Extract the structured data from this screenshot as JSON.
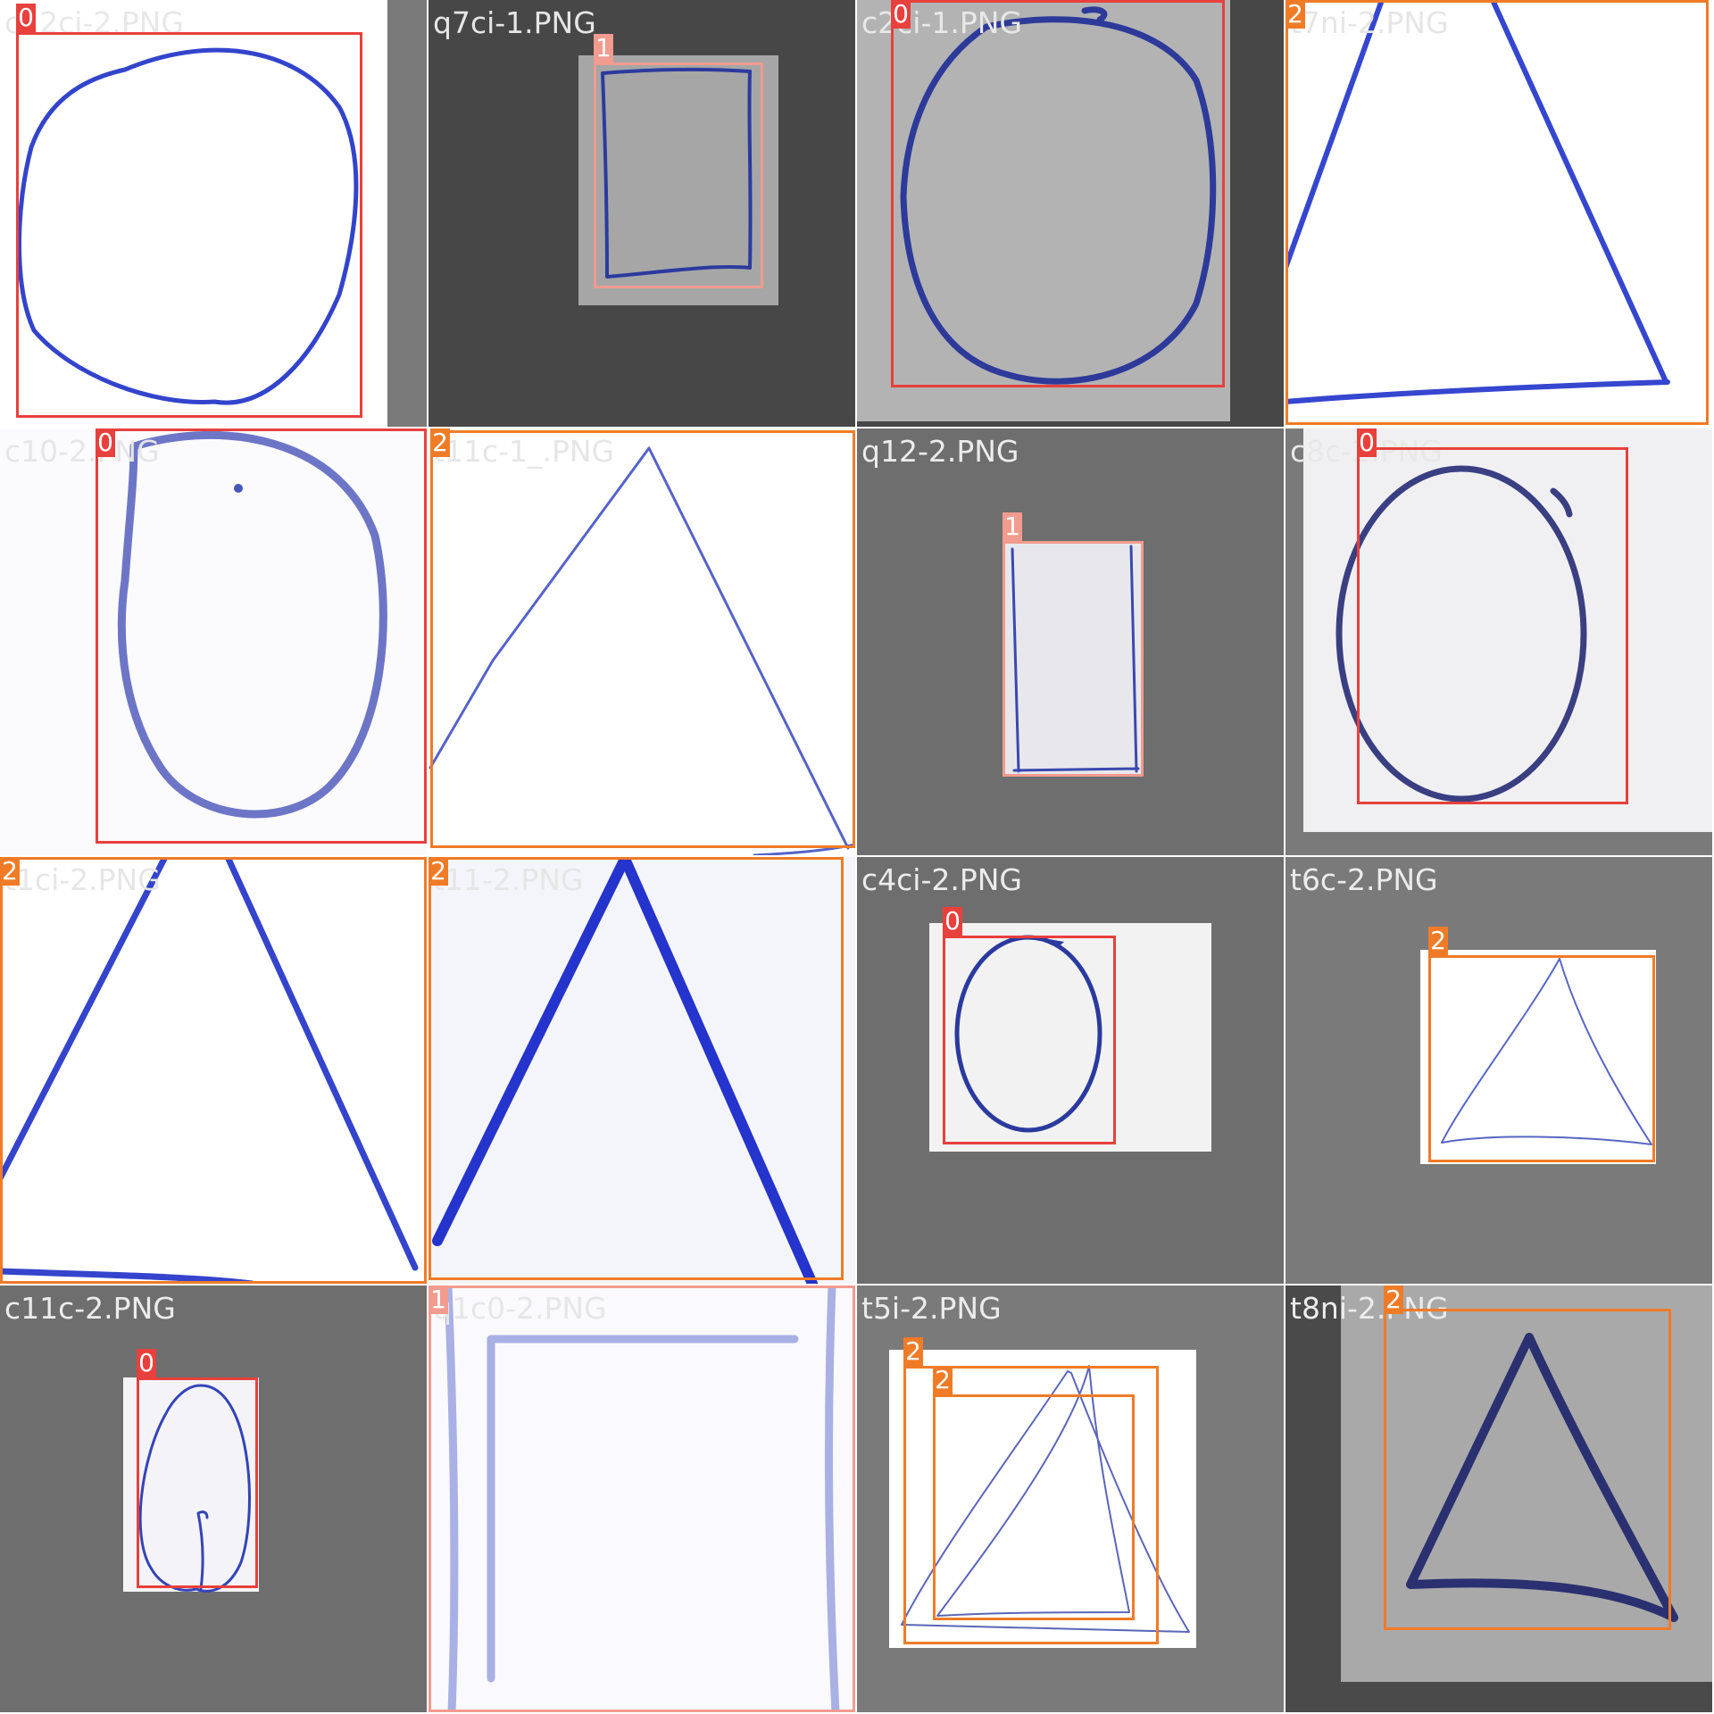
{
  "mosaic": {
    "title": "",
    "class_colors": {
      "0": "#e8403c",
      "1": "#f29b8f",
      "2": "#f07b27"
    },
    "label_text_color": "#ffffff",
    "tiles": [
      {
        "filename": "c12ci-2.PNG",
        "background": "#7a7a7a",
        "paper": "#ffffff",
        "ink": "#3344cc",
        "shape": "circle",
        "filename_color": "#e8e8e8",
        "boxes": [
          {
            "class_id": "0"
          }
        ]
      },
      {
        "filename": "q7ci-1.PNG",
        "background": "#474747",
        "paper": "#a6a6a6",
        "ink": "#2c3a9e",
        "shape": "square",
        "filename_color": "#e6e6e6",
        "boxes": [
          {
            "class_id": "1"
          }
        ]
      },
      {
        "filename": "c2ci-1.PNG",
        "background": "#474747",
        "paper": "#b3b3b3",
        "ink": "#2d3a9a",
        "shape": "circle",
        "filename_color": "#e8e8e8",
        "boxes": [
          {
            "class_id": "0"
          }
        ]
      },
      {
        "filename": "t7ni-2.PNG",
        "background": "#ffffff",
        "paper": "#ffffff",
        "ink": "#3546cf",
        "shape": "triangle",
        "filename_color": "#e6e6e6",
        "boxes": [
          {
            "class_id": "2"
          }
        ]
      },
      {
        "filename": "c10-2.PNG",
        "background": "#ffffff",
        "paper": "#fbfbfe",
        "ink": "#4a55b8",
        "shape": "circle",
        "filename_color": "#e6e6e6",
        "boxes": [
          {
            "class_id": "0"
          }
        ]
      },
      {
        "filename": "t11c-1_.PNG",
        "background": "#ffffff",
        "paper": "#ffffff",
        "ink": "#5563c8",
        "shape": "triangle",
        "filename_color": "#e6e6e6",
        "boxes": [
          {
            "class_id": "2"
          }
        ]
      },
      {
        "filename": "q12-2.PNG",
        "background": "#6e6e6e",
        "paper": "#e8e8ec",
        "ink": "#3a48b0",
        "shape": "rectangle",
        "filename_color": "#ececec",
        "boxes": [
          {
            "class_id": "1"
          }
        ]
      },
      {
        "filename": "c8c-2.PNG",
        "background": "#7a7a7a",
        "paper": "#f0f0f2",
        "ink": "#3a3f82",
        "shape": "ellipse",
        "filename_color": "#e8e8e8",
        "boxes": [
          {
            "class_id": "0"
          }
        ]
      },
      {
        "filename": "t1ci-2.PNG",
        "background": "#ffffff",
        "paper": "#ffffff",
        "ink": "#3444cc",
        "shape": "triangle",
        "filename_color": "#e6e6e6",
        "boxes": [
          {
            "class_id": "2"
          }
        ]
      },
      {
        "filename": "t11-2.PNG",
        "background": "#f4f5fb",
        "paper": "#f4f5fb",
        "ink": "#2434cc",
        "shape": "triangle",
        "filename_color": "#e6e6e6",
        "boxes": [
          {
            "class_id": "2"
          }
        ]
      },
      {
        "filename": "c4ci-2.PNG",
        "background": "#6e6e6e",
        "paper": "#f2f2f2",
        "ink": "#2a3a9e",
        "shape": "ellipse",
        "filename_color": "#ececec",
        "boxes": [
          {
            "class_id": "0"
          }
        ]
      },
      {
        "filename": "t6c-2.PNG",
        "background": "#7a7a7a",
        "paper": "#ffffff",
        "ink": "#5866c4",
        "shape": "triangle",
        "filename_color": "#ececec",
        "boxes": [
          {
            "class_id": "2"
          }
        ]
      },
      {
        "filename": "c11c-2.PNG",
        "background": "#6e6e6e",
        "paper": "#f4f4f8",
        "ink": "#3444b8",
        "shape": "leaf",
        "filename_color": "#ececec",
        "boxes": [
          {
            "class_id": "0"
          }
        ]
      },
      {
        "filename": "q1c0-2.PNG",
        "background": "#ffffff",
        "paper": "#fafafe",
        "ink": "#6672d0",
        "shape": "square",
        "filename_color": "#e6e6e6",
        "boxes": [
          {
            "class_id": "1"
          }
        ]
      },
      {
        "filename": "t5i-2.PNG",
        "background": "#7a7a7a",
        "paper": "#ffffff",
        "ink": "#5a66b8",
        "shape": "double-triangle",
        "filename_color": "#ececec",
        "boxes": [
          {
            "class_id": "2"
          },
          {
            "class_id": "2"
          }
        ]
      },
      {
        "filename": "t8ni-2.PNG",
        "background": "#4a4a4a",
        "paper": "#a9a9a9",
        "ink": "#2a3070",
        "shape": "triangle",
        "filename_color": "#ececec",
        "boxes": [
          {
            "class_id": "2"
          }
        ]
      }
    ]
  }
}
